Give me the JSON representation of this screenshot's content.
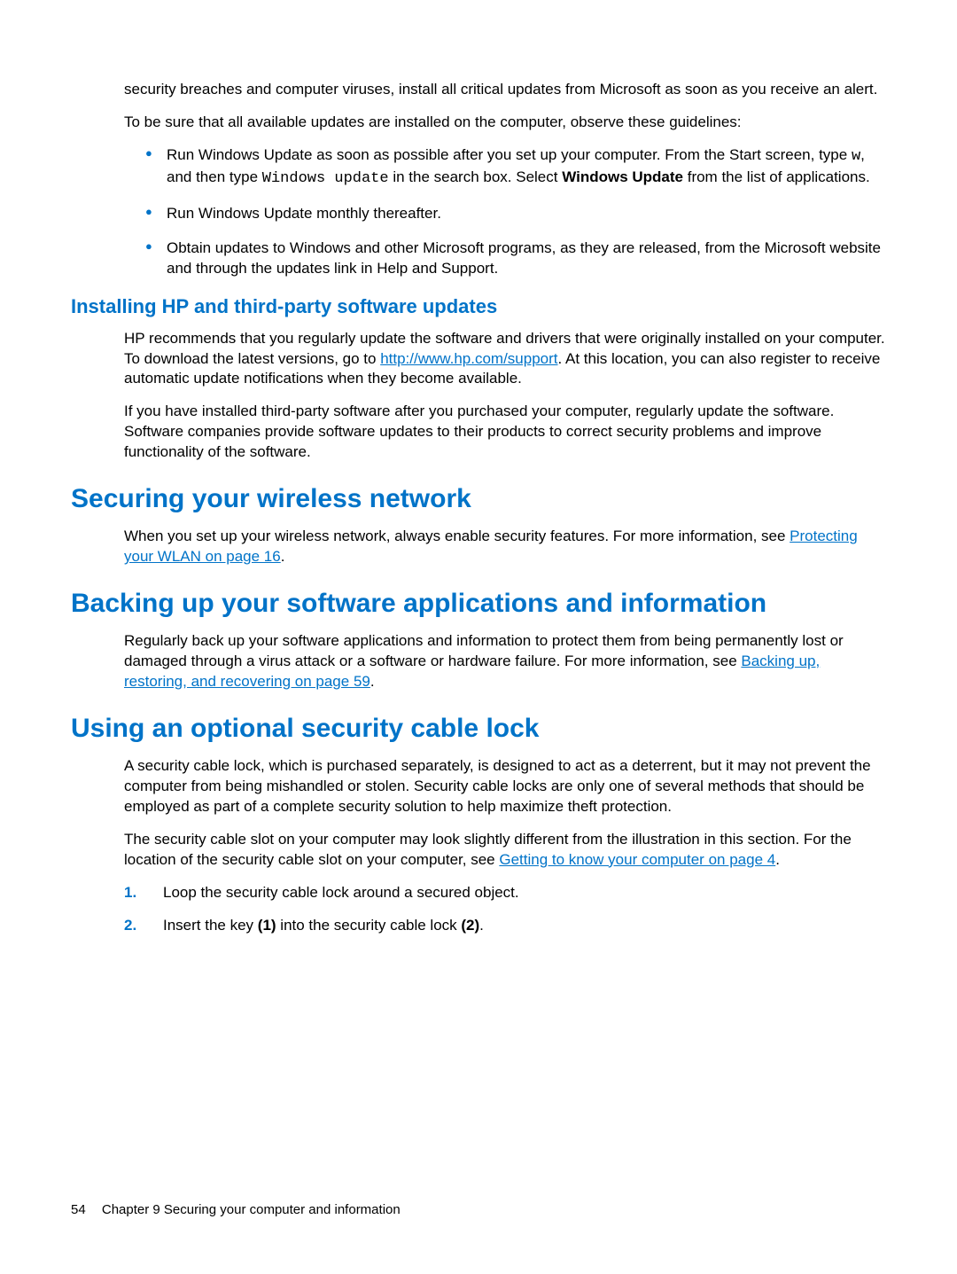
{
  "intro": {
    "p1": "security breaches and computer viruses, install all critical updates from Microsoft as soon as you receive an alert.",
    "p2": "To be sure that all available updates are installed on the computer, observe these guidelines:",
    "bullets": {
      "b1_pre": "Run Windows Update as soon as possible after you set up your computer. From the Start screen, type ",
      "b1_m1": "w",
      "b1_mid": ", and then type ",
      "b1_m2": "Windows update",
      "b1_mid2": " in the search box. Select ",
      "b1_bold": "Windows Update",
      "b1_post": " from the list of applications.",
      "b2": "Run Windows Update monthly thereafter.",
      "b3": "Obtain updates to Windows and other Microsoft programs, as they are released, from the Microsoft website and through the updates link in Help and Support."
    }
  },
  "installing": {
    "heading": "Installing HP and third-party software updates",
    "p1_pre": "HP recommends that you regularly update the software and drivers that were originally installed on your computer. To download the latest versions, go to ",
    "p1_link": "http://www.hp.com/support",
    "p1_post": ". At this location, you can also register to receive automatic update notifications when they become available.",
    "p2": "If you have installed third-party software after you purchased your computer, regularly update the software. Software companies provide software updates to their products to correct security problems and improve functionality of the software."
  },
  "securing": {
    "heading": "Securing your wireless network",
    "p1_pre": "When you set up your wireless network, always enable security features. For more information, see ",
    "p1_link": "Protecting your WLAN on page 16",
    "p1_post": "."
  },
  "backing": {
    "heading": "Backing up your software applications and information",
    "p1_pre": "Regularly back up your software applications and information to protect them from being permanently lost or damaged through a virus attack or a software or hardware failure. For more information, see ",
    "p1_link": "Backing up, restoring, and recovering on page 59",
    "p1_post": "."
  },
  "cable": {
    "heading": "Using an optional security cable lock",
    "p1": "A security cable lock, which is purchased separately, is designed to act as a deterrent, but it may not prevent the computer from being mishandled or stolen. Security cable locks are only one of several methods that should be employed as part of a complete security solution to help maximize theft protection.",
    "p2_pre": "The security cable slot on your computer may look slightly different from the illustration in this section. For the location of the security cable slot on your computer, see ",
    "p2_link": "Getting to know your computer on page 4",
    "p2_post": ".",
    "step1_num": "1.",
    "step1": "Loop the security cable lock around a secured object.",
    "step2_num": "2.",
    "step2_pre": "Insert the key ",
    "step2_b1": "(1)",
    "step2_mid": " into the security cable lock ",
    "step2_b2": "(2)",
    "step2_post": "."
  },
  "footer": {
    "page": "54",
    "chapter": "Chapter 9   Securing your computer and information"
  }
}
